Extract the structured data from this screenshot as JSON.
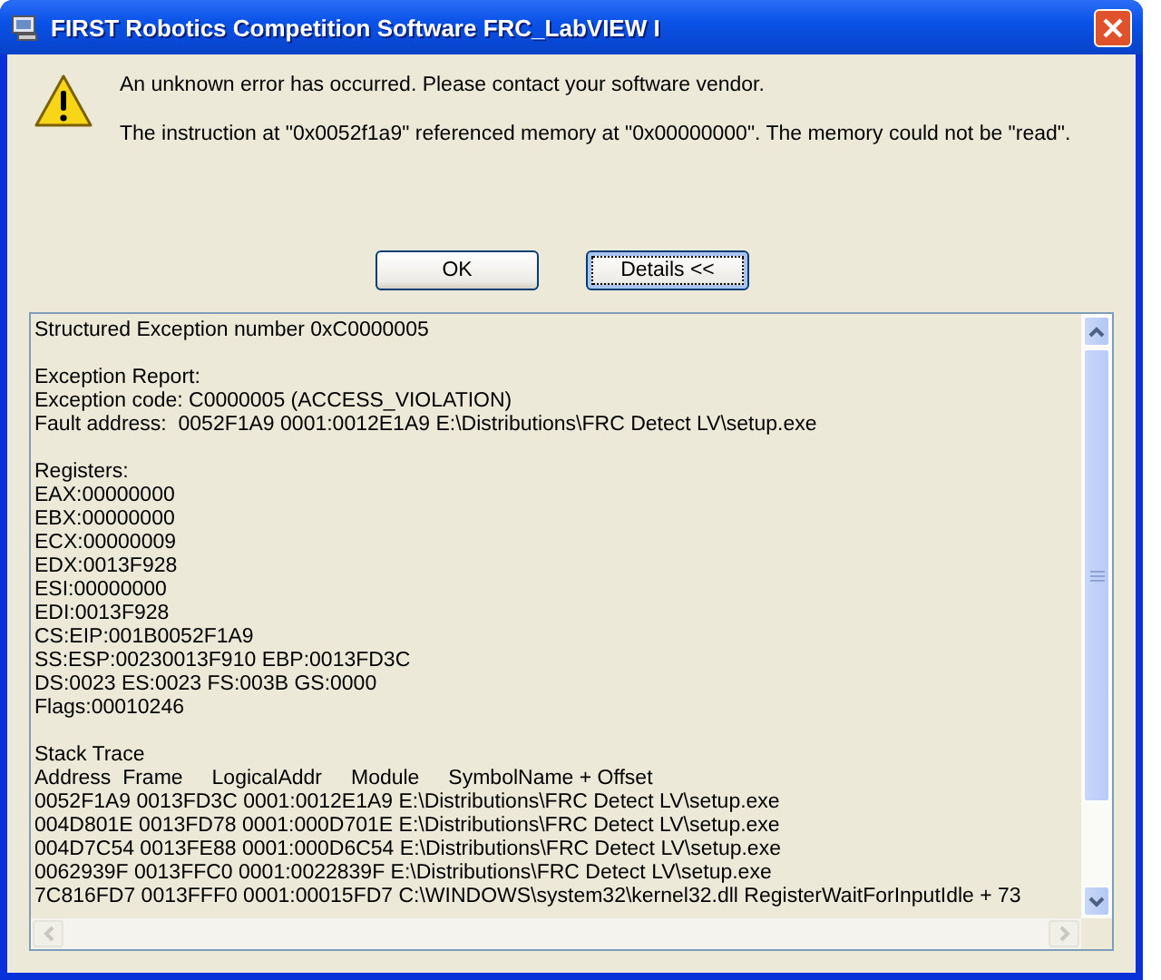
{
  "window": {
    "title": "FIRST Robotics Competition Software FRC_LabVIEW I"
  },
  "messages": [
    "An unknown error has occurred. Please contact your software vendor.",
    "The instruction at \"0x0052f1a9\" referenced memory at \"0x00000000\". The memory could not be \"read\"."
  ],
  "buttons": [
    {
      "label": "OK",
      "focused": false
    },
    {
      "label": "Details <<",
      "focused": true
    }
  ],
  "details": [
    [
      "Structured Exception number 0xC0000005"
    ],
    [
      "Exception Report:",
      "Exception code: C0000005 (ACCESS_VIOLATION)",
      "Fault address:  0052F1A9 0001:0012E1A9 E:\\Distributions\\FRC Detect LV\\setup.exe"
    ],
    [
      "Registers:",
      "EAX:00000000",
      "EBX:00000000",
      "ECX:00000009",
      "EDX:0013F928",
      "ESI:00000000",
      "EDI:0013F928",
      "CS:EIP:001B0052F1A9",
      "SS:ESP:00230013F910 EBP:0013FD3C",
      "DS:0023 ES:0023 FS:003B GS:0000",
      "Flags:00010246"
    ],
    [
      "Stack Trace",
      "Address  Frame     LogicalAddr     Module     SymbolName + Offset",
      "0052F1A9 0013FD3C 0001:0012E1A9 E:\\Distributions\\FRC Detect LV\\setup.exe",
      "004D801E 0013FD78 0001:000D701E E:\\Distributions\\FRC Detect LV\\setup.exe",
      "004D7C54 0013FE88 0001:000D6C54 E:\\Distributions\\FRC Detect LV\\setup.exe",
      "0062939F 0013FFC0 0001:0022839F E:\\Distributions\\FRC Detect LV\\setup.exe",
      "7C816FD7 0013FFF0 0001:00015FD7 C:\\WINDOWS\\system32\\kernel32.dll RegisterWaitForInputIdle + 73"
    ]
  ]
}
